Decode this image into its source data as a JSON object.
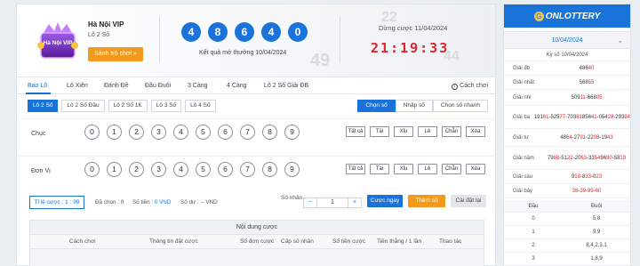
{
  "game": {
    "title": "Hà Nội VIP",
    "subtitle": "Lô 2 Số",
    "lobby_button": "Sảnh trò chơi »",
    "logo_text": "Hà Nội VIP"
  },
  "result": {
    "balls": [
      "4",
      "8",
      "6",
      "4",
      "0"
    ],
    "date_label": "Kết quả mở thưởng 10/04/2024"
  },
  "countdown": {
    "label": "Dừng cược 11/04/2024",
    "time": "21:19:33"
  },
  "tabs": [
    "Bao Lô",
    "Lô Xiên",
    "Đánh Đề",
    "Đầu Đuôi",
    "3 Càng",
    "4 Càng",
    "Lô 2 Số Giải ĐB"
  ],
  "rules_label": "Cách chơi",
  "subtabs": [
    "Lô 2 Số",
    "Lô 2 Số Đầu",
    "Lô 2 Số 1K",
    "Lô 3 Số",
    "Lô 4 Số"
  ],
  "modes": [
    "Chọn số",
    "Nhập số",
    "Chọn số nhanh"
  ],
  "rows": [
    {
      "label": "Chục",
      "numbers": [
        "0",
        "1",
        "2",
        "3",
        "4",
        "5",
        "6",
        "7",
        "8",
        "9"
      ]
    },
    {
      "label": "Đơn Vị",
      "numbers": [
        "0",
        "1",
        "2",
        "3",
        "4",
        "5",
        "6",
        "7",
        "8",
        "9"
      ]
    }
  ],
  "quick_buttons": [
    "Tất cả",
    "Tài",
    "Xỉu",
    "Lẻ",
    "Chẵn",
    "Xóa"
  ],
  "betbar": {
    "ratio": "Tỉ lệ cược : 1 : 99",
    "selected": "Đã chọn : 0",
    "amount_label": "Số tiền :",
    "amount_value": "0 VND",
    "balance_label": "Số dư :",
    "balance_value": "-- VND",
    "multiplier_label": "Số nhân :",
    "multiplier": "1",
    "bet_now": "Cược ngay",
    "add_number": "Thêm số",
    "reset": "Cài đặt lại"
  },
  "content": {
    "title": "Nội dung cược",
    "columns": [
      "Cách chơi",
      "Thông tin đặt cược",
      "Số đơn cược",
      "Cấp số nhân",
      "Số tiền cược",
      "Tiền thắng / 1 lần",
      "Thao tác"
    ]
  },
  "sidebar": {
    "brand": "ONLOTTERY",
    "date": "10/04/2024",
    "period": "Kỳ số 10/04/2024",
    "prizes": [
      {
        "name": "Giải đb",
        "lines": [
          {
            "plain": "486",
            "red": "40"
          }
        ]
      },
      {
        "name": "Giải nhất",
        "lines": [
          {
            "plain": "568",
            "red": "55"
          }
        ]
      },
      {
        "name": "Giải nhì",
        "lines": [
          {
            "plain": "509",
            "red": "11"
          },
          {
            "plain": "-668",
            "red": "05"
          }
        ]
      },
      {
        "name": "Giải ba",
        "lines": [
          {
            "plain": "191",
            "red": "61"
          },
          {
            "plain": "-525",
            "red": "77"
          },
          {
            "plain": "-703",
            "red": "81"
          },
          {
            "plain": "856",
            "red": "41"
          },
          {
            "plain": "-054",
            "red": "28"
          },
          {
            "plain": "-293",
            "red": "84"
          }
        ]
      },
      {
        "name": "Giải tư",
        "lines": [
          {
            "plain": "48",
            "red": "64"
          },
          {
            "plain": "-27",
            "red": "91"
          },
          {
            "plain": "-22",
            "red": "08"
          },
          {
            "plain": "-19",
            "red": "43"
          }
        ]
      },
      {
        "name": "Giải năm",
        "lines": [
          {
            "plain": "79",
            "red": "88"
          },
          {
            "plain": "-51",
            "red": "22"
          },
          {
            "plain": "-20",
            "red": "63"
          },
          {
            "plain": "-33",
            "red": "54"
          },
          {
            "plain": "96",
            "red": "90"
          },
          {
            "plain": "-58",
            "red": "19"
          }
        ]
      },
      {
        "name": "Giải sáu",
        "lines": [
          {
            "plain": "9",
            "red": "18"
          },
          {
            "plain": "-8",
            "red": "33"
          },
          {
            "plain": "-0",
            "red": "23"
          }
        ]
      },
      {
        "name": "Giải bảy",
        "lines": [
          {
            "plain": "",
            "red": "38"
          },
          {
            "plain": "-",
            "red": "39"
          },
          {
            "plain": "-",
            "red": "99"
          },
          {
            "plain": "-",
            "red": "60"
          }
        ]
      }
    ],
    "headtail_cols": [
      "Đầu",
      "Đuôi"
    ],
    "headtail": [
      {
        "head": "0",
        "tail": "5,8"
      },
      {
        "head": "1",
        "tail": "9,9"
      },
      {
        "head": "2",
        "tail": "8,4,2,3,1"
      },
      {
        "head": "3",
        "tail": "1,8,9"
      }
    ]
  }
}
